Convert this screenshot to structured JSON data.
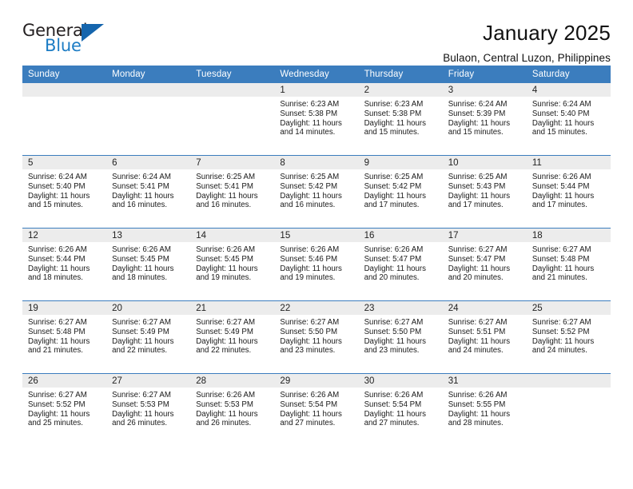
{
  "brand": {
    "name_part1": "General",
    "name_part2": "Blue",
    "triangle_color": "#1565ad",
    "blue_text_color": "#1c7cc4"
  },
  "header": {
    "title": "January 2025",
    "subtitle": "Bulaon, Central Luzon, Philippines"
  },
  "theme": {
    "header_bar_color": "#3b7dbe",
    "daynum_band_color": "#ececec",
    "text_color": "#111111"
  },
  "weekday_headers": [
    "Sunday",
    "Monday",
    "Tuesday",
    "Wednesday",
    "Thursday",
    "Friday",
    "Saturday"
  ],
  "weeks": [
    {
      "days": [
        {
          "date": "",
          "sunrise": "",
          "sunset": "",
          "daylight": "",
          "empty": true
        },
        {
          "date": "",
          "sunrise": "",
          "sunset": "",
          "daylight": "",
          "empty": true
        },
        {
          "date": "",
          "sunrise": "",
          "sunset": "",
          "daylight": "",
          "empty": true
        },
        {
          "date": "1",
          "sunrise": "Sunrise: 6:23 AM",
          "sunset": "Sunset: 5:38 PM",
          "daylight": "Daylight: 11 hours and 14 minutes."
        },
        {
          "date": "2",
          "sunrise": "Sunrise: 6:23 AM",
          "sunset": "Sunset: 5:38 PM",
          "daylight": "Daylight: 11 hours and 15 minutes."
        },
        {
          "date": "3",
          "sunrise": "Sunrise: 6:24 AM",
          "sunset": "Sunset: 5:39 PM",
          "daylight": "Daylight: 11 hours and 15 minutes."
        },
        {
          "date": "4",
          "sunrise": "Sunrise: 6:24 AM",
          "sunset": "Sunset: 5:40 PM",
          "daylight": "Daylight: 11 hours and 15 minutes."
        }
      ]
    },
    {
      "days": [
        {
          "date": "5",
          "sunrise": "Sunrise: 6:24 AM",
          "sunset": "Sunset: 5:40 PM",
          "daylight": "Daylight: 11 hours and 15 minutes."
        },
        {
          "date": "6",
          "sunrise": "Sunrise: 6:24 AM",
          "sunset": "Sunset: 5:41 PM",
          "daylight": "Daylight: 11 hours and 16 minutes."
        },
        {
          "date": "7",
          "sunrise": "Sunrise: 6:25 AM",
          "sunset": "Sunset: 5:41 PM",
          "daylight": "Daylight: 11 hours and 16 minutes."
        },
        {
          "date": "8",
          "sunrise": "Sunrise: 6:25 AM",
          "sunset": "Sunset: 5:42 PM",
          "daylight": "Daylight: 11 hours and 16 minutes."
        },
        {
          "date": "9",
          "sunrise": "Sunrise: 6:25 AM",
          "sunset": "Sunset: 5:42 PM",
          "daylight": "Daylight: 11 hours and 17 minutes."
        },
        {
          "date": "10",
          "sunrise": "Sunrise: 6:25 AM",
          "sunset": "Sunset: 5:43 PM",
          "daylight": "Daylight: 11 hours and 17 minutes."
        },
        {
          "date": "11",
          "sunrise": "Sunrise: 6:26 AM",
          "sunset": "Sunset: 5:44 PM",
          "daylight": "Daylight: 11 hours and 17 minutes."
        }
      ]
    },
    {
      "days": [
        {
          "date": "12",
          "sunrise": "Sunrise: 6:26 AM",
          "sunset": "Sunset: 5:44 PM",
          "daylight": "Daylight: 11 hours and 18 minutes."
        },
        {
          "date": "13",
          "sunrise": "Sunrise: 6:26 AM",
          "sunset": "Sunset: 5:45 PM",
          "daylight": "Daylight: 11 hours and 18 minutes."
        },
        {
          "date": "14",
          "sunrise": "Sunrise: 6:26 AM",
          "sunset": "Sunset: 5:45 PM",
          "daylight": "Daylight: 11 hours and 19 minutes."
        },
        {
          "date": "15",
          "sunrise": "Sunrise: 6:26 AM",
          "sunset": "Sunset: 5:46 PM",
          "daylight": "Daylight: 11 hours and 19 minutes."
        },
        {
          "date": "16",
          "sunrise": "Sunrise: 6:26 AM",
          "sunset": "Sunset: 5:47 PM",
          "daylight": "Daylight: 11 hours and 20 minutes."
        },
        {
          "date": "17",
          "sunrise": "Sunrise: 6:27 AM",
          "sunset": "Sunset: 5:47 PM",
          "daylight": "Daylight: 11 hours and 20 minutes."
        },
        {
          "date": "18",
          "sunrise": "Sunrise: 6:27 AM",
          "sunset": "Sunset: 5:48 PM",
          "daylight": "Daylight: 11 hours and 21 minutes."
        }
      ]
    },
    {
      "days": [
        {
          "date": "19",
          "sunrise": "Sunrise: 6:27 AM",
          "sunset": "Sunset: 5:48 PM",
          "daylight": "Daylight: 11 hours and 21 minutes."
        },
        {
          "date": "20",
          "sunrise": "Sunrise: 6:27 AM",
          "sunset": "Sunset: 5:49 PM",
          "daylight": "Daylight: 11 hours and 22 minutes."
        },
        {
          "date": "21",
          "sunrise": "Sunrise: 6:27 AM",
          "sunset": "Sunset: 5:49 PM",
          "daylight": "Daylight: 11 hours and 22 minutes."
        },
        {
          "date": "22",
          "sunrise": "Sunrise: 6:27 AM",
          "sunset": "Sunset: 5:50 PM",
          "daylight": "Daylight: 11 hours and 23 minutes."
        },
        {
          "date": "23",
          "sunrise": "Sunrise: 6:27 AM",
          "sunset": "Sunset: 5:50 PM",
          "daylight": "Daylight: 11 hours and 23 minutes."
        },
        {
          "date": "24",
          "sunrise": "Sunrise: 6:27 AM",
          "sunset": "Sunset: 5:51 PM",
          "daylight": "Daylight: 11 hours and 24 minutes."
        },
        {
          "date": "25",
          "sunrise": "Sunrise: 6:27 AM",
          "sunset": "Sunset: 5:52 PM",
          "daylight": "Daylight: 11 hours and 24 minutes."
        }
      ]
    },
    {
      "days": [
        {
          "date": "26",
          "sunrise": "Sunrise: 6:27 AM",
          "sunset": "Sunset: 5:52 PM",
          "daylight": "Daylight: 11 hours and 25 minutes."
        },
        {
          "date": "27",
          "sunrise": "Sunrise: 6:27 AM",
          "sunset": "Sunset: 5:53 PM",
          "daylight": "Daylight: 11 hours and 26 minutes."
        },
        {
          "date": "28",
          "sunrise": "Sunrise: 6:26 AM",
          "sunset": "Sunset: 5:53 PM",
          "daylight": "Daylight: 11 hours and 26 minutes."
        },
        {
          "date": "29",
          "sunrise": "Sunrise: 6:26 AM",
          "sunset": "Sunset: 5:54 PM",
          "daylight": "Daylight: 11 hours and 27 minutes."
        },
        {
          "date": "30",
          "sunrise": "Sunrise: 6:26 AM",
          "sunset": "Sunset: 5:54 PM",
          "daylight": "Daylight: 11 hours and 27 minutes."
        },
        {
          "date": "31",
          "sunrise": "Sunrise: 6:26 AM",
          "sunset": "Sunset: 5:55 PM",
          "daylight": "Daylight: 11 hours and 28 minutes."
        },
        {
          "date": "",
          "sunrise": "",
          "sunset": "",
          "daylight": "",
          "empty": true
        }
      ]
    }
  ]
}
